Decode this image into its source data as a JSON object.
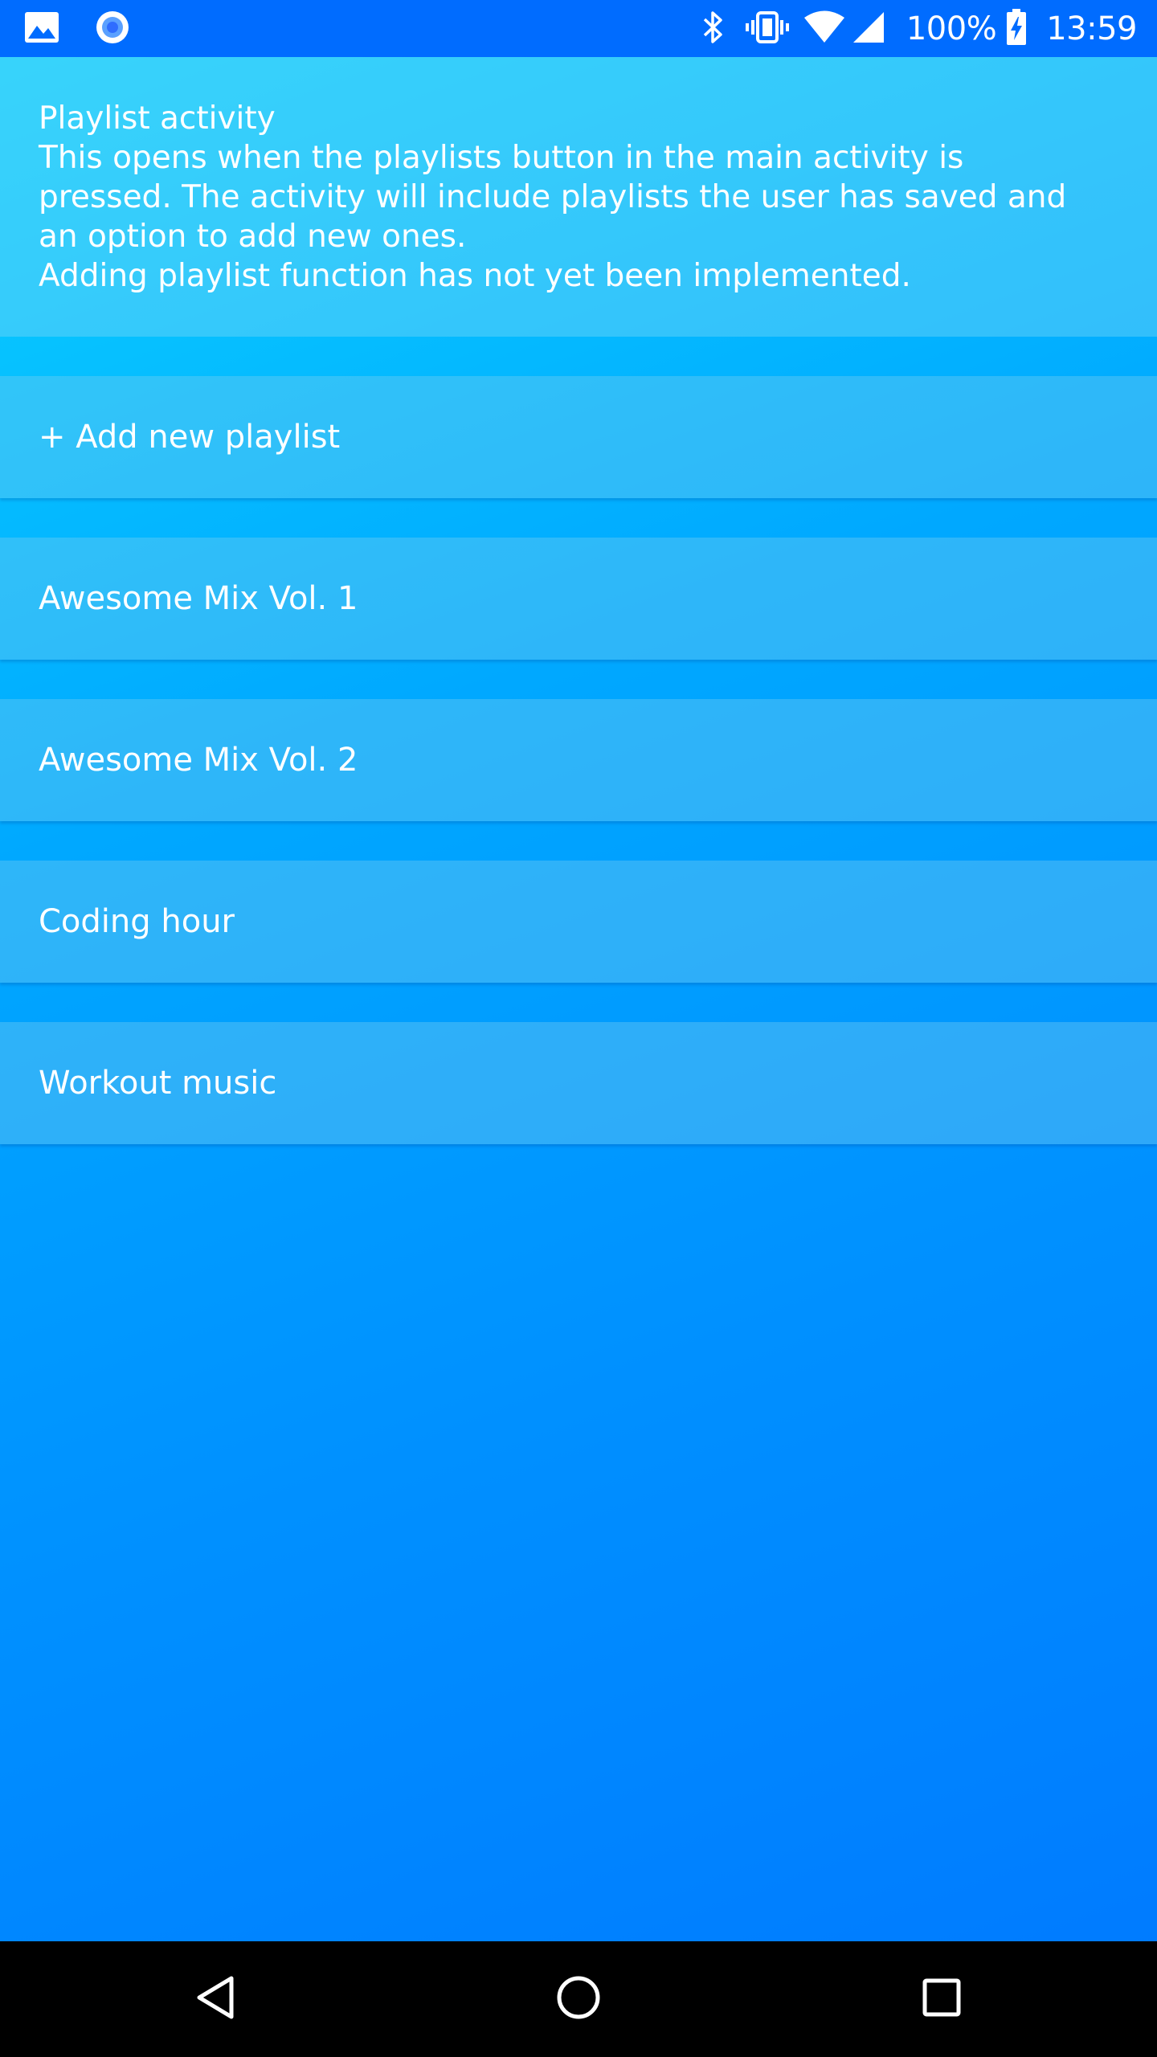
{
  "status_bar": {
    "notification_icons": [
      "image-icon",
      "record-icon"
    ],
    "system_icons": [
      "bluetooth-icon",
      "vibrate-icon",
      "wifi-icon",
      "cell-signal-icon",
      "battery-charging-icon"
    ],
    "battery_percent": "100%",
    "time": "13:59"
  },
  "info": {
    "title": "Playlist activity",
    "line1": "This opens when the playlists button in the main activity is",
    "line2": "pressed. The activity will include playlists the user has saved and",
    "line3": "an option to add new ones.",
    "line4": "Adding playlist function has not yet been implemented."
  },
  "playlist_list": {
    "items": [
      {
        "label": "+ Add new playlist"
      },
      {
        "label": "Awesome Mix Vol. 1"
      },
      {
        "label": "Awesome Mix Vol. 2"
      },
      {
        "label": "Coding hour"
      },
      {
        "label": "Workout music"
      }
    ]
  },
  "nav_bar": {
    "buttons": [
      "back-icon",
      "home-icon",
      "recents-icon"
    ]
  },
  "colors": {
    "status_bar": "#006cff",
    "background_top": "#0bd4ff",
    "background_bottom": "#0078ff",
    "nav_bar": "#000000",
    "text": "#ffffff"
  }
}
